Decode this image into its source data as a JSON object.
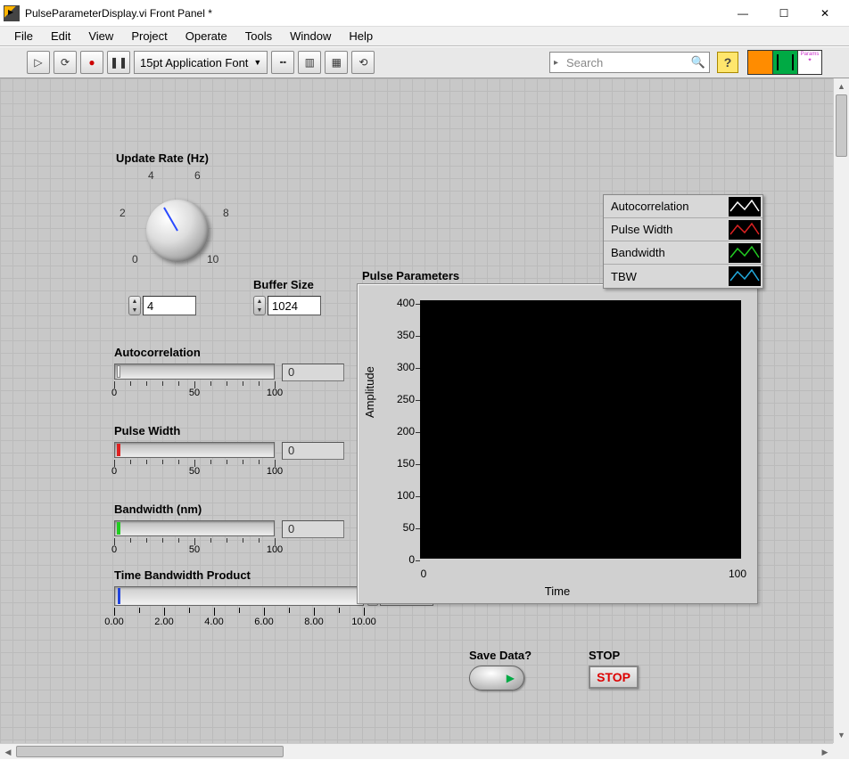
{
  "window": {
    "title": "PulseParameterDisplay.vi Front Panel *"
  },
  "menu": {
    "items": [
      "File",
      "Edit",
      "View",
      "Project",
      "Operate",
      "Tools",
      "Window",
      "Help"
    ]
  },
  "toolbar": {
    "font_label": "15pt Application Font",
    "search_placeholder": "Search"
  },
  "controls": {
    "update_rate": {
      "label": "Update Rate (Hz)",
      "ticks": [
        "0",
        "2",
        "4",
        "6",
        "8",
        "10"
      ],
      "value": "4"
    },
    "buffer_size": {
      "label": "Buffer Size",
      "value": "1024"
    },
    "autocorrelation": {
      "label": "Autocorrelation",
      "value": "0",
      "ticks": [
        "0",
        "50",
        "100"
      ]
    },
    "pulse_width": {
      "label": "Pulse Width",
      "value": "0",
      "ticks": [
        "0",
        "50",
        "100"
      ]
    },
    "bandwidth": {
      "label": "Bandwidth (nm)",
      "value": "0",
      "ticks": [
        "0",
        "50",
        "100"
      ]
    },
    "tbw": {
      "label": "Time Bandwidth Product",
      "value": "0.00",
      "ticks": [
        "0.00",
        "2.00",
        "4.00",
        "6.00",
        "8.00",
        "10.00"
      ]
    },
    "save": {
      "label": "Save Data?"
    },
    "stop": {
      "label": "STOP",
      "button": "STOP"
    }
  },
  "chart_data": {
    "type": "line",
    "title": "Pulse Parameters",
    "xlabel": "Time",
    "ylabel": "Amplitude",
    "xlim": [
      0,
      100
    ],
    "ylim": [
      0,
      400
    ],
    "xticks": [
      0,
      100
    ],
    "yticks": [
      0,
      50,
      100,
      150,
      200,
      250,
      300,
      350,
      400
    ],
    "series": [
      {
        "name": "Autocorrelation",
        "color": "#ffffff",
        "values": []
      },
      {
        "name": "Pulse Width",
        "color": "#d22",
        "values": []
      },
      {
        "name": "Bandwidth",
        "color": "#2c2",
        "values": []
      },
      {
        "name": "TBW",
        "color": "#2ad",
        "values": []
      }
    ]
  }
}
